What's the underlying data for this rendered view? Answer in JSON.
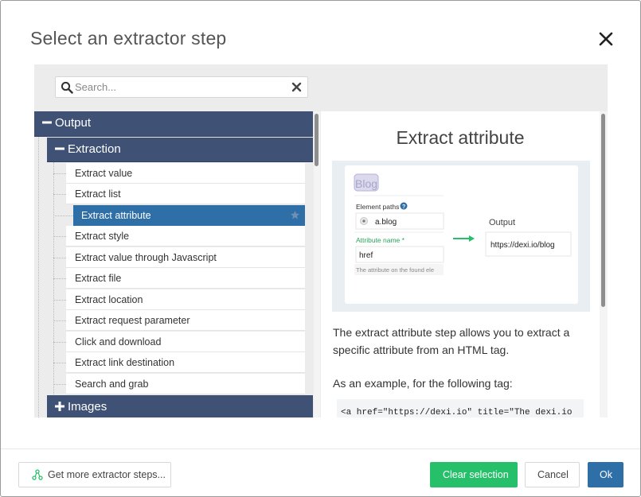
{
  "dialog": {
    "title": "Select an extractor step"
  },
  "search": {
    "placeholder": "Search..."
  },
  "tree": {
    "output_label": "Output",
    "extraction_label": "Extraction",
    "images_label": "Images",
    "items": [
      {
        "label": "Extract value"
      },
      {
        "label": "Extract list"
      },
      {
        "label": "Extract attribute",
        "selected": true
      },
      {
        "label": "Extract style"
      },
      {
        "label": "Extract value through Javascript"
      },
      {
        "label": "Extract file"
      },
      {
        "label": "Extract location"
      },
      {
        "label": "Extract request parameter"
      },
      {
        "label": "Click and download"
      },
      {
        "label": "Extract link destination"
      },
      {
        "label": "Search and grab"
      }
    ]
  },
  "preview": {
    "title": "Extract attribute",
    "image": {
      "heading_text": "Blog",
      "element_paths_label": "Element paths",
      "element_path_value": "a.blog",
      "attribute_name_label": "Attribute name *",
      "attribute_name_value": "href",
      "helper_text": "The attribute on the found ele",
      "output_label": "Output",
      "output_value": "https://dexi.io/blog"
    },
    "description": "The extract attribute step allows you to extract a specific attribute from an HTML tag.",
    "example_intro": "As an example, for the following tag:",
    "code_snippet": "<a href=\"https://dexi.io\" title=\"The dexi.io"
  },
  "footer": {
    "more_steps_label": "Get more extractor steps...",
    "clear_label": "Clear selection",
    "cancel_label": "Cancel",
    "ok_label": "Ok"
  },
  "colors": {
    "header_bg": "#3f5175",
    "selected_bg": "#2f6fa8",
    "clear_button": "#27c06a",
    "ok_button": "#2f6fa8"
  }
}
